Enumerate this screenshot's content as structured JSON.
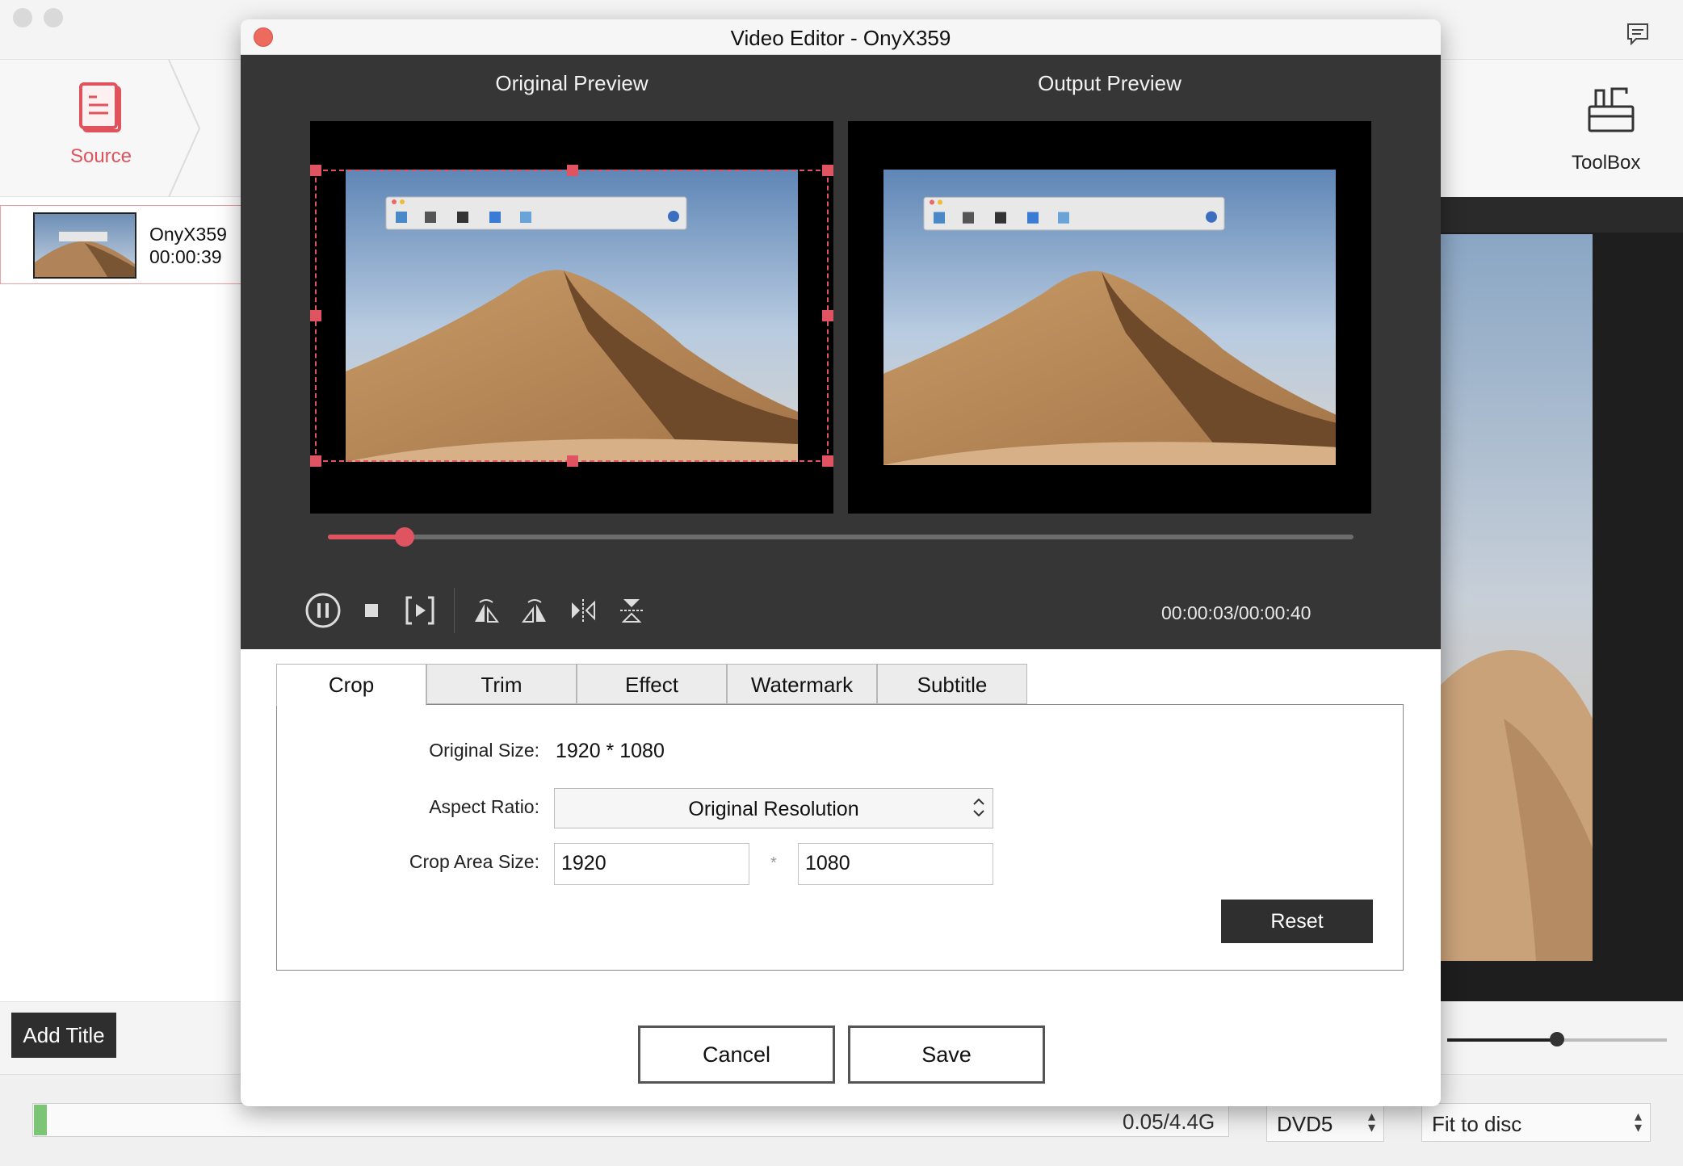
{
  "app": {
    "nav": {
      "source_label": "Source",
      "toolbox_label": "ToolBox"
    },
    "file": {
      "name": "OnyX359",
      "duration": "00:00:39"
    },
    "add_title_label": "Add Title",
    "bottom": {
      "capacity_text": "0.05/4.4G",
      "capacity_fraction": 0.011,
      "disc_type": "DVD5",
      "fit_mode": "Fit to disc"
    },
    "volume_fraction": 0.5
  },
  "dialog": {
    "title": "Video Editor - OnyX359",
    "original_preview_label": "Original Preview",
    "output_preview_label": "Output Preview",
    "playback": {
      "current": "00:00:03",
      "total": "00:00:40",
      "time_text": "00:00:03/00:00:40",
      "progress_fraction": 0.075
    },
    "controls": [
      "pause-icon",
      "stop-icon",
      "next-frame-icon",
      "rotate-left-icon",
      "rotate-right-icon",
      "flip-horizontal-icon",
      "flip-vertical-icon"
    ],
    "tabs": [
      "Crop",
      "Trim",
      "Effect",
      "Watermark",
      "Subtitle"
    ],
    "active_tab": "Crop",
    "crop": {
      "original_size_label": "Original Size:",
      "original_size_value": "1920 * 1080",
      "aspect_ratio_label": "Aspect Ratio:",
      "aspect_ratio_value": "Original Resolution",
      "crop_area_label": "Crop Area Size:",
      "crop_width": "1920",
      "crop_height": "1080",
      "times_sign": "*",
      "reset_label": "Reset"
    },
    "cancel_label": "Cancel",
    "save_label": "Save"
  },
  "colors": {
    "accent": "#e05360",
    "dark_panel": "#363636",
    "button_dark": "#2f2f2f"
  }
}
